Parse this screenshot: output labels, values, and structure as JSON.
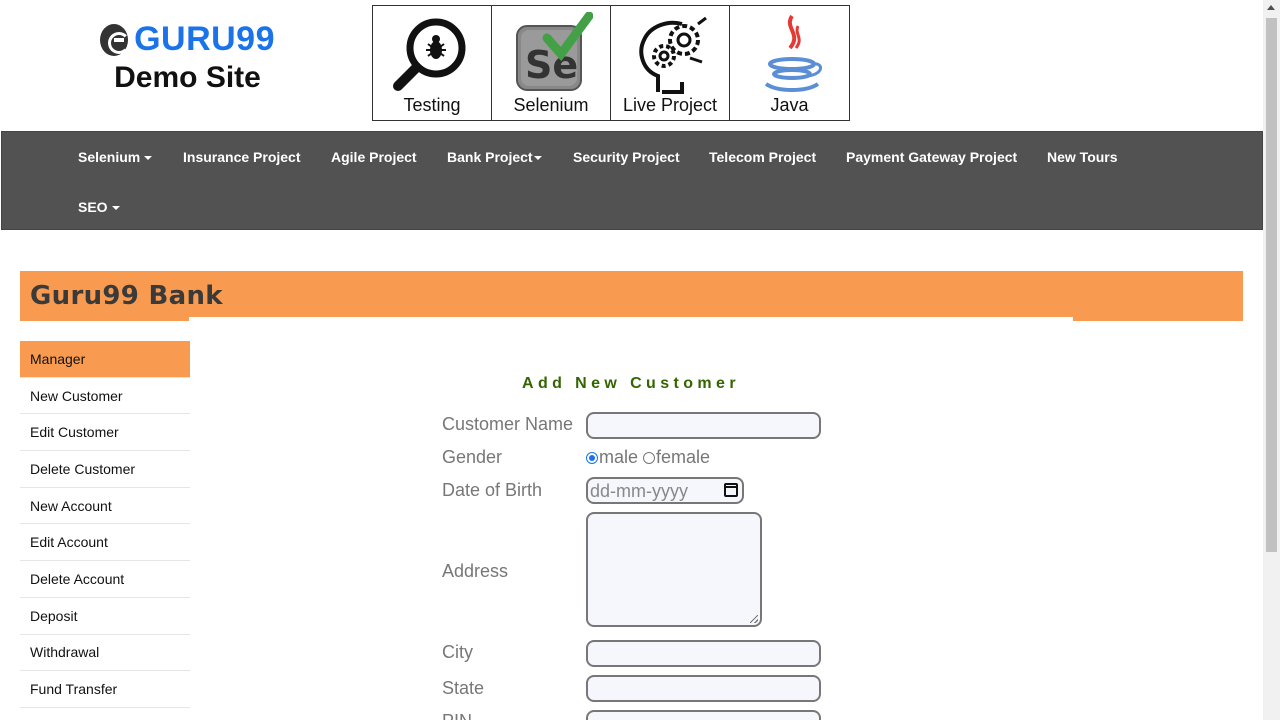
{
  "logo": {
    "brand": "GURU99",
    "subtitle": "Demo Site"
  },
  "courses": [
    {
      "label": "Testing",
      "icon": "magnifier-bug-icon"
    },
    {
      "label": "Selenium",
      "icon": "selenium-icon"
    },
    {
      "label": "Live Project",
      "icon": "gears-head-icon"
    },
    {
      "label": "Java",
      "icon": "java-icon"
    }
  ],
  "nav": {
    "selenium": "Selenium",
    "insurance": "Insurance Project",
    "agile": "Agile Project",
    "bank": "Bank Project",
    "security": "Security Project",
    "telecom": "Telecom Project",
    "payment": "Payment Gateway Project",
    "newtours": "New Tours",
    "seo": "SEO"
  },
  "bank": {
    "title": "Guru99 Bank"
  },
  "sidebar": {
    "items": [
      {
        "label": "Manager",
        "active": true
      },
      {
        "label": "New Customer"
      },
      {
        "label": "Edit Customer"
      },
      {
        "label": "Delete Customer"
      },
      {
        "label": "New Account"
      },
      {
        "label": "Edit Account"
      },
      {
        "label": "Delete Account"
      },
      {
        "label": "Deposit"
      },
      {
        "label": "Withdrawal"
      },
      {
        "label": "Fund Transfer"
      }
    ]
  },
  "form": {
    "title": "Add New Customer",
    "customer_name": {
      "label": "Customer Name",
      "value": ""
    },
    "gender": {
      "label": "Gender",
      "options": [
        "male",
        "female"
      ],
      "selected": "male"
    },
    "dob": {
      "label": "Date of Birth",
      "placeholder": "dd-mm-yyyy"
    },
    "address": {
      "label": "Address",
      "value": ""
    },
    "city": {
      "label": "City",
      "value": ""
    },
    "state": {
      "label": "State",
      "value": ""
    },
    "pin": {
      "label": "PIN",
      "value": ""
    }
  },
  "colors": {
    "accent": "#f89b50",
    "nav_bg": "#525252",
    "form_title": "#336600",
    "brand_blue": "#1a73e8"
  }
}
